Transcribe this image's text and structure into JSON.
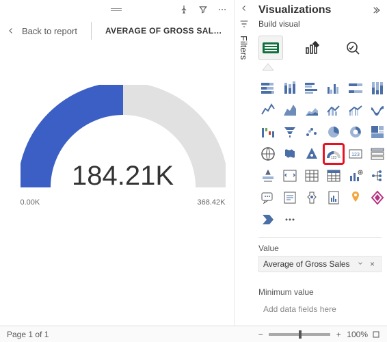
{
  "header": {
    "back_label": "Back to report",
    "title": "AVERAGE OF GROSS SAL…"
  },
  "filters": {
    "label": "Filters"
  },
  "chart_data": {
    "type": "gauge",
    "value_display": "184.21K",
    "value": 184.21,
    "min": 0.0,
    "max": 368.42,
    "min_display": "0.00K",
    "max_display": "368.42K",
    "unit_suffix": "K",
    "fill_ratio": 0.5,
    "fill_color": "#3b5fc4",
    "empty_color": "#e1e1e1"
  },
  "viz": {
    "panel_title": "Visualizations",
    "subtitle": "Build visual",
    "tabs": [
      "Build",
      "Format",
      "Analytics"
    ],
    "gallery": [
      "stacked-bar",
      "stacked-column",
      "clustered-bar",
      "clustered-column",
      "100-stacked-bar",
      "100-stacked-column",
      "line",
      "area",
      "stacked-area",
      "line-stacked-column",
      "line-clustered-column",
      "ribbon",
      "waterfall",
      "funnel",
      "scatter",
      "pie",
      "donut",
      "treemap",
      "map",
      "filled-map",
      "azure-map",
      "gauge",
      "card",
      "multi-row-card",
      "kpi",
      "slicer",
      "table",
      "matrix",
      "r-visual",
      "decomposition-tree",
      "qa",
      "smart-narrative",
      "key-influencers",
      "paginated",
      "arcgis",
      "power-apps",
      "power-automate",
      "more"
    ],
    "highlighted": "gauge",
    "fields": {
      "value_label": "Value",
      "value_well": "Average of Gross Sales",
      "min_label": "Minimum value",
      "min_placeholder": "Add data fields here"
    }
  },
  "status": {
    "page": "Page 1 of 1",
    "zoom": "100%",
    "zoom_value": 100
  }
}
